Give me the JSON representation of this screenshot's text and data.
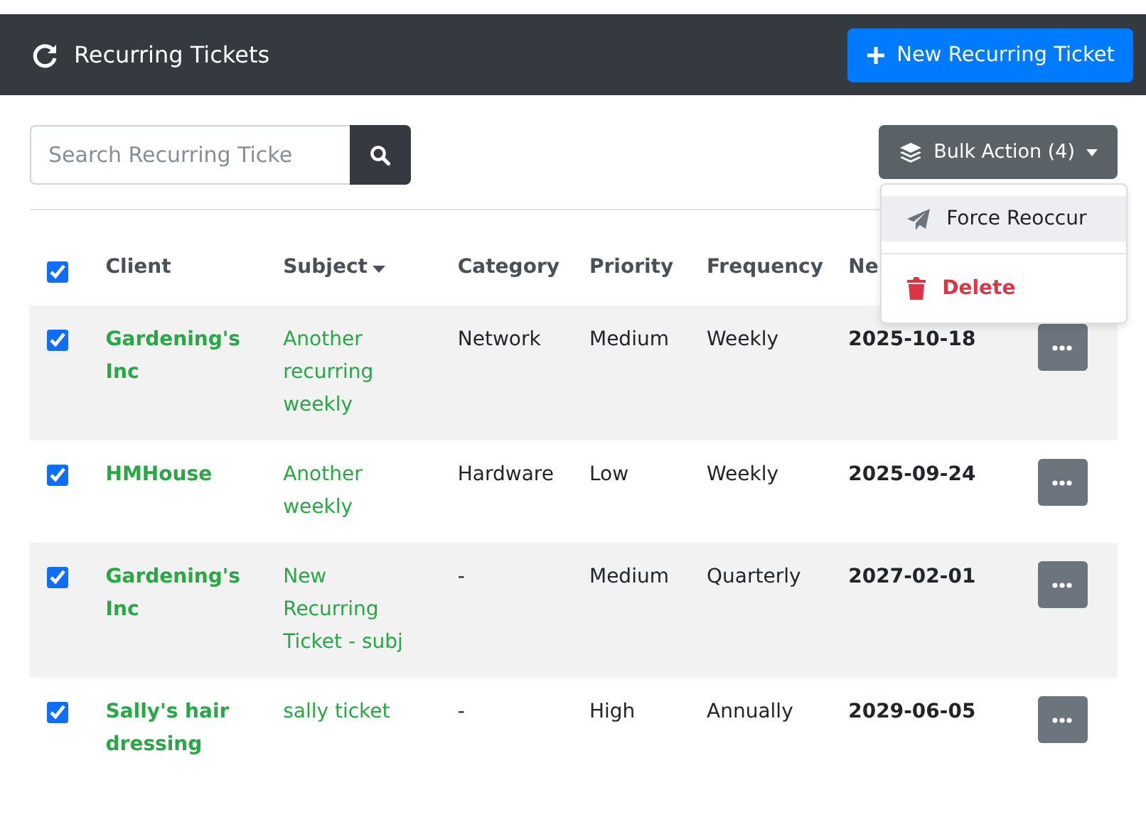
{
  "header": {
    "title": "Recurring Tickets",
    "new_button": "New Recurring Ticket"
  },
  "search": {
    "placeholder": "Search Recurring Ticke"
  },
  "bulk_action": {
    "label": "Bulk Action (4)",
    "menu": [
      {
        "label": "Force Reoccur",
        "kind": "normal",
        "highlighted": true
      },
      {
        "label": "Delete",
        "kind": "danger",
        "highlighted": false
      }
    ]
  },
  "table": {
    "all_checked": true,
    "columns": [
      {
        "label": "Client",
        "sorted": false
      },
      {
        "label": "Subject",
        "sorted": true
      },
      {
        "label": "Category",
        "sorted": false
      },
      {
        "label": "Priority",
        "sorted": false
      },
      {
        "label": "Frequency",
        "sorted": false
      },
      {
        "label": "Ne",
        "sorted": false
      }
    ],
    "rows": [
      {
        "checked": true,
        "client": "Gardening's Inc",
        "subject": "Another recurring weekly",
        "category": "Network",
        "priority": "Medium",
        "frequency": "Weekly",
        "next": "2025-10-18"
      },
      {
        "checked": true,
        "client": "HMHouse",
        "subject": "Another weekly",
        "category": "Hardware",
        "priority": "Low",
        "frequency": "Weekly",
        "next": "2025-09-24"
      },
      {
        "checked": true,
        "client": "Gardening's Inc",
        "subject": "New Recurring Ticket - subj",
        "category": "-",
        "priority": "Medium",
        "frequency": "Quarterly",
        "next": "2027-02-01"
      },
      {
        "checked": true,
        "client": "Sally's hair dressing",
        "subject": "sally ticket",
        "category": "-",
        "priority": "High",
        "frequency": "Annually",
        "next": "2029-06-05"
      }
    ]
  }
}
